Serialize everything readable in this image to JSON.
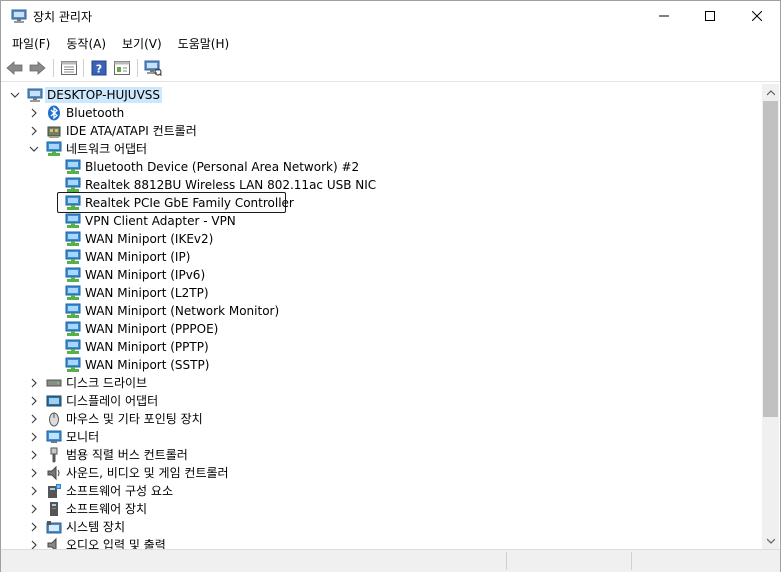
{
  "window": {
    "title": "장치 관리자",
    "icon": "device-manager-icon"
  },
  "menu": [
    {
      "label": "파일(F)"
    },
    {
      "label": "동작(A)"
    },
    {
      "label": "보기(V)"
    },
    {
      "label": "도움말(H)"
    }
  ],
  "toolbar": {
    "back_icon": "back-arrow-icon",
    "forward_icon": "forward-arrow-icon",
    "properties_icon": "properties-icon",
    "help_icon": "help-icon",
    "view_icon": "view-icon",
    "scan_icon": "scan-hardware-icon"
  },
  "tree": {
    "root": {
      "label": "DESKTOP-HUJUVSS",
      "icon": "computer-icon",
      "expanded": true
    },
    "categories_before": [
      {
        "label": "Bluetooth",
        "icon": "bluetooth-icon",
        "expanded": false
      },
      {
        "label": "IDE ATA/ATAPI 컨트롤러",
        "icon": "ide-controller-icon",
        "expanded": false
      }
    ],
    "network": {
      "label": "네트워크 어댑터",
      "icon": "network-adapter-icon",
      "expanded": true,
      "items": [
        {
          "label": "Bluetooth Device (Personal Area Network) #2"
        },
        {
          "label": "Realtek 8812BU Wireless LAN 802.11ac USB NIC"
        },
        {
          "label": "Realtek PCIe GbE Family Controller",
          "selected": true
        },
        {
          "label": "VPN Client Adapter - VPN"
        },
        {
          "label": "WAN Miniport (IKEv2)"
        },
        {
          "label": "WAN Miniport (IP)"
        },
        {
          "label": "WAN Miniport (IPv6)"
        },
        {
          "label": "WAN Miniport (L2TP)"
        },
        {
          "label": "WAN Miniport (Network Monitor)"
        },
        {
          "label": "WAN Miniport (PPPOE)"
        },
        {
          "label": "WAN Miniport (PPTP)"
        },
        {
          "label": "WAN Miniport (SSTP)"
        }
      ]
    },
    "categories_after": [
      {
        "label": "디스크 드라이브",
        "icon": "disk-drive-icon"
      },
      {
        "label": "디스플레이 어댑터",
        "icon": "display-adapter-icon"
      },
      {
        "label": "마우스 및 기타 포인팅 장치",
        "icon": "mouse-icon"
      },
      {
        "label": "모니터",
        "icon": "monitor-icon"
      },
      {
        "label": "범용 직렬 버스 컨트롤러",
        "icon": "usb-icon"
      },
      {
        "label": "사운드, 비디오 및 게임 컨트롤러",
        "icon": "speaker-icon"
      },
      {
        "label": "소프트웨어 구성 요소",
        "icon": "software-component-icon"
      },
      {
        "label": "소프트웨어 장치",
        "icon": "software-device-icon"
      },
      {
        "label": "시스템 장치",
        "icon": "system-device-icon"
      },
      {
        "label": "오디오 입력 및 출력",
        "icon": "audio-io-icon"
      }
    ]
  },
  "colors": {
    "selection": "#cce8ff",
    "network_icon": "#3a8fd6",
    "network_icon_green": "#58b04a"
  }
}
